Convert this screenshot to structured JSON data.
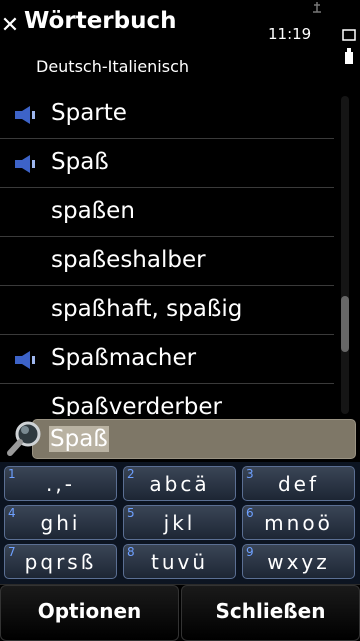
{
  "header": {
    "title": "Wörterbuch",
    "clock": "11:19",
    "subtitle": "Deutsch-Italienisch"
  },
  "list": {
    "items": [
      {
        "label": "Sparte",
        "audio": true
      },
      {
        "label": "Spaß",
        "audio": true
      },
      {
        "label": "spaßen",
        "audio": false
      },
      {
        "label": "spaßeshalber",
        "audio": false
      },
      {
        "label": "spaßhaft, spaßig",
        "audio": false
      },
      {
        "label": "Spaßmacher",
        "audio": true
      },
      {
        "label": "Spaßverderber",
        "audio": false
      }
    ]
  },
  "search": {
    "value": "Spaß"
  },
  "keypad": {
    "keys": [
      {
        "num": "1",
        "letters": ".,-"
      },
      {
        "num": "2",
        "letters": "abcä"
      },
      {
        "num": "3",
        "letters": "def"
      },
      {
        "num": "4",
        "letters": "ghi"
      },
      {
        "num": "5",
        "letters": "jkl"
      },
      {
        "num": "6",
        "letters": "mnoö"
      },
      {
        "num": "7",
        "letters": "pqrsß"
      },
      {
        "num": "8",
        "letters": "tuvü"
      },
      {
        "num": "9",
        "letters": "wxyz"
      }
    ]
  },
  "softkeys": {
    "left": "Optionen",
    "right": "Schließen"
  },
  "colors": {
    "keypad_bg": "#0c1421",
    "key_number": "#6ea0ff",
    "search_bg": "#7e7767",
    "speaker_icon": "#3d63c8"
  }
}
